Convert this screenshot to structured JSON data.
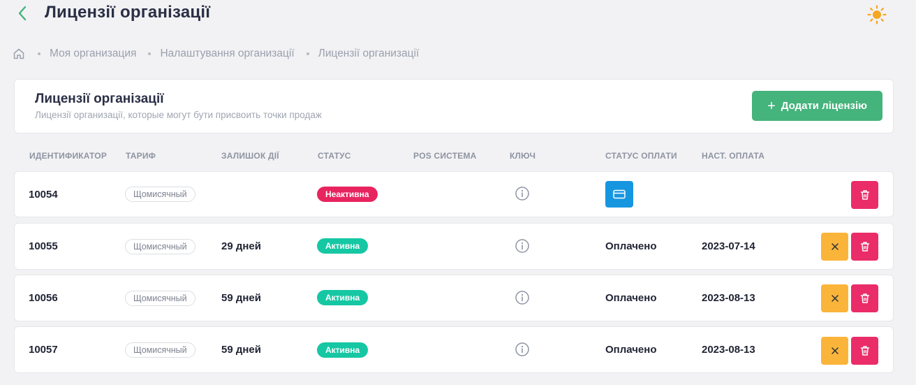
{
  "header": {
    "title": "Лицензії організації"
  },
  "breadcrumb": {
    "home_icon": "home-icon",
    "items": [
      "Моя организация",
      "Налаштування организації",
      "Лицензії организації"
    ]
  },
  "card": {
    "title": "Лицензії організації",
    "subtitle": "Лицензії организації, которые могут бути присвоить точки продаж",
    "add_button": {
      "icon": "plus-icon",
      "label": "Додати ліцензію"
    }
  },
  "table": {
    "columns": [
      "ИДЕНТИФИКАТОР",
      "ТАРИФ",
      "ЗАЛИШОК ДІЇ",
      "СТАТУС",
      "POS СИСТЕМА",
      "КЛЮЧ",
      "СТАТУС ОПЛАТИ",
      "НАСТ. ОПЛАТА"
    ],
    "rows": [
      {
        "id": "10054",
        "tariff": "Щомисячный",
        "remaining": "",
        "status": "Неактивна",
        "pos": "",
        "payment_status": "",
        "next_payment": ""
      },
      {
        "id": "10055",
        "tariff": "Щомисячный",
        "remaining": "29 дней",
        "status": "Активна",
        "pos": "",
        "payment_status": "Оплачено",
        "next_payment": "2023-07-14"
      },
      {
        "id": "10056",
        "tariff": "Щомисячный",
        "remaining": "59 дней",
        "status": "Активна",
        "pos": "",
        "payment_status": "Оплачено",
        "next_payment": "2023-08-13"
      },
      {
        "id": "10057",
        "tariff": "Щомисячный",
        "remaining": "59 дней",
        "status": "Активна",
        "pos": "",
        "payment_status": "Оплачено",
        "next_payment": "2023-08-13"
      }
    ]
  },
  "colors": {
    "primary_green": "#45b37c",
    "status_active": "#16c7a3",
    "status_inactive": "#e8245f",
    "pay_blue": "#1796e0",
    "cancel_orange": "#fbb43a",
    "delete_red": "#ea2c68",
    "theme_sun": "#f5a623"
  },
  "icons": {
    "back": "chevron-left-icon",
    "theme": "sun-icon",
    "key": "info-icon",
    "pay": "credit-card-icon",
    "cancel": "close-icon",
    "delete": "trash-icon"
  }
}
